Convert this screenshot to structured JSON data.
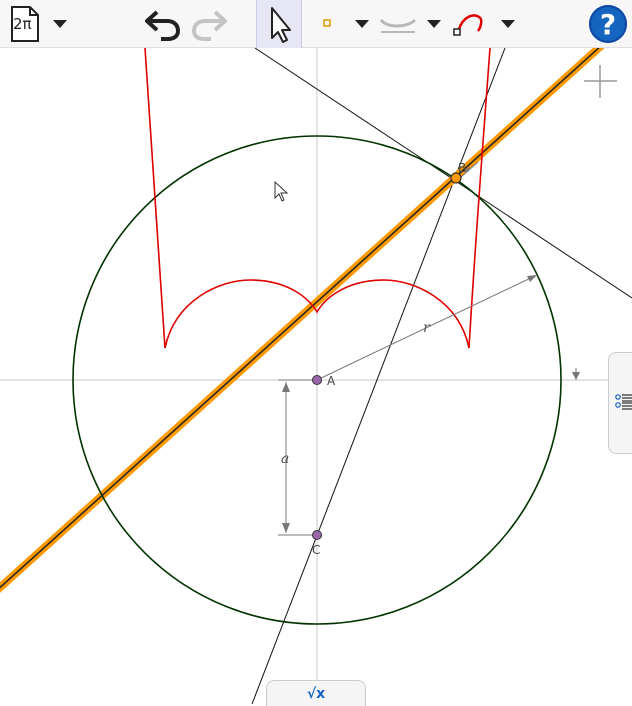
{
  "toolbar": {
    "menu_label": "2π",
    "help_label": "?"
  },
  "canvas": {
    "points": [
      {
        "label": "A"
      },
      {
        "label": "B"
      },
      {
        "label": "C"
      }
    ],
    "measurements": {
      "radius_label": "r",
      "distance_label": "a"
    }
  },
  "algebra_tab": {
    "symbol": "√x"
  },
  "colors": {
    "toolbar_bg": "#f7f7f7",
    "circle": "#003300",
    "locus_curve": "#e00000",
    "highlight_line": "#ff9900",
    "help_accent": "#1565c0",
    "point_fill": "#9966aa"
  }
}
